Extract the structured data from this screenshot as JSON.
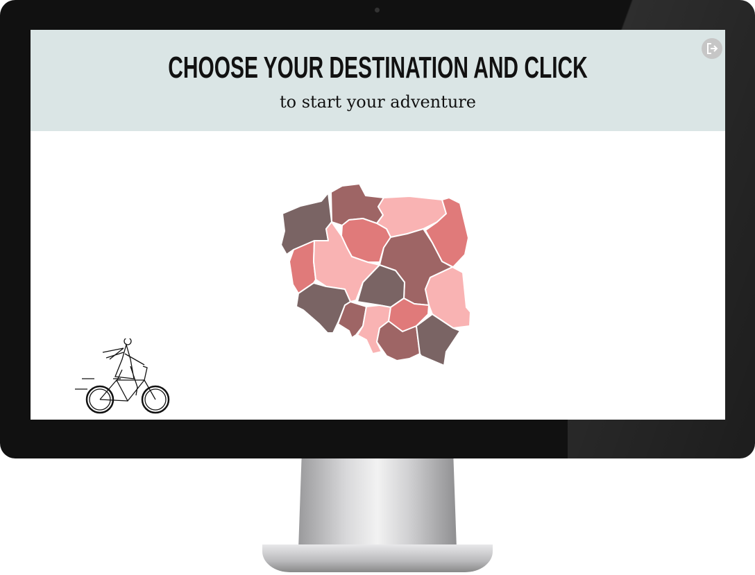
{
  "header": {
    "title": "CHOOSE YOUR DESTINATION AND CLICK",
    "subtitle": "to start your adventure",
    "exit_icon": "exit-icon"
  },
  "colors": {
    "header_bg": "#dae5e5",
    "dark": "#7a6464",
    "medium": "#9e6565",
    "red": "#e07a7a",
    "pink": "#f9b3b3"
  },
  "map": {
    "regions": [
      {
        "id": "zachodniopomorskie",
        "tone": "dark"
      },
      {
        "id": "pomorskie",
        "tone": "medium"
      },
      {
        "id": "warminsko-mazurskie",
        "tone": "pink"
      },
      {
        "id": "podlaskie",
        "tone": "red"
      },
      {
        "id": "kujawsko-pomorskie",
        "tone": "red"
      },
      {
        "id": "mazowieckie",
        "tone": "medium"
      },
      {
        "id": "lubuskie",
        "tone": "red"
      },
      {
        "id": "wielkopolskie",
        "tone": "pink"
      },
      {
        "id": "lodzkie",
        "tone": "dark"
      },
      {
        "id": "lubelskie",
        "tone": "pink"
      },
      {
        "id": "dolnoslaskie",
        "tone": "dark"
      },
      {
        "id": "opolskie",
        "tone": "medium"
      },
      {
        "id": "slaskie",
        "tone": "pink"
      },
      {
        "id": "swietokrzyskie",
        "tone": "red"
      },
      {
        "id": "malopolskie",
        "tone": "medium"
      },
      {
        "id": "podkarpackie",
        "tone": "dark"
      }
    ]
  }
}
